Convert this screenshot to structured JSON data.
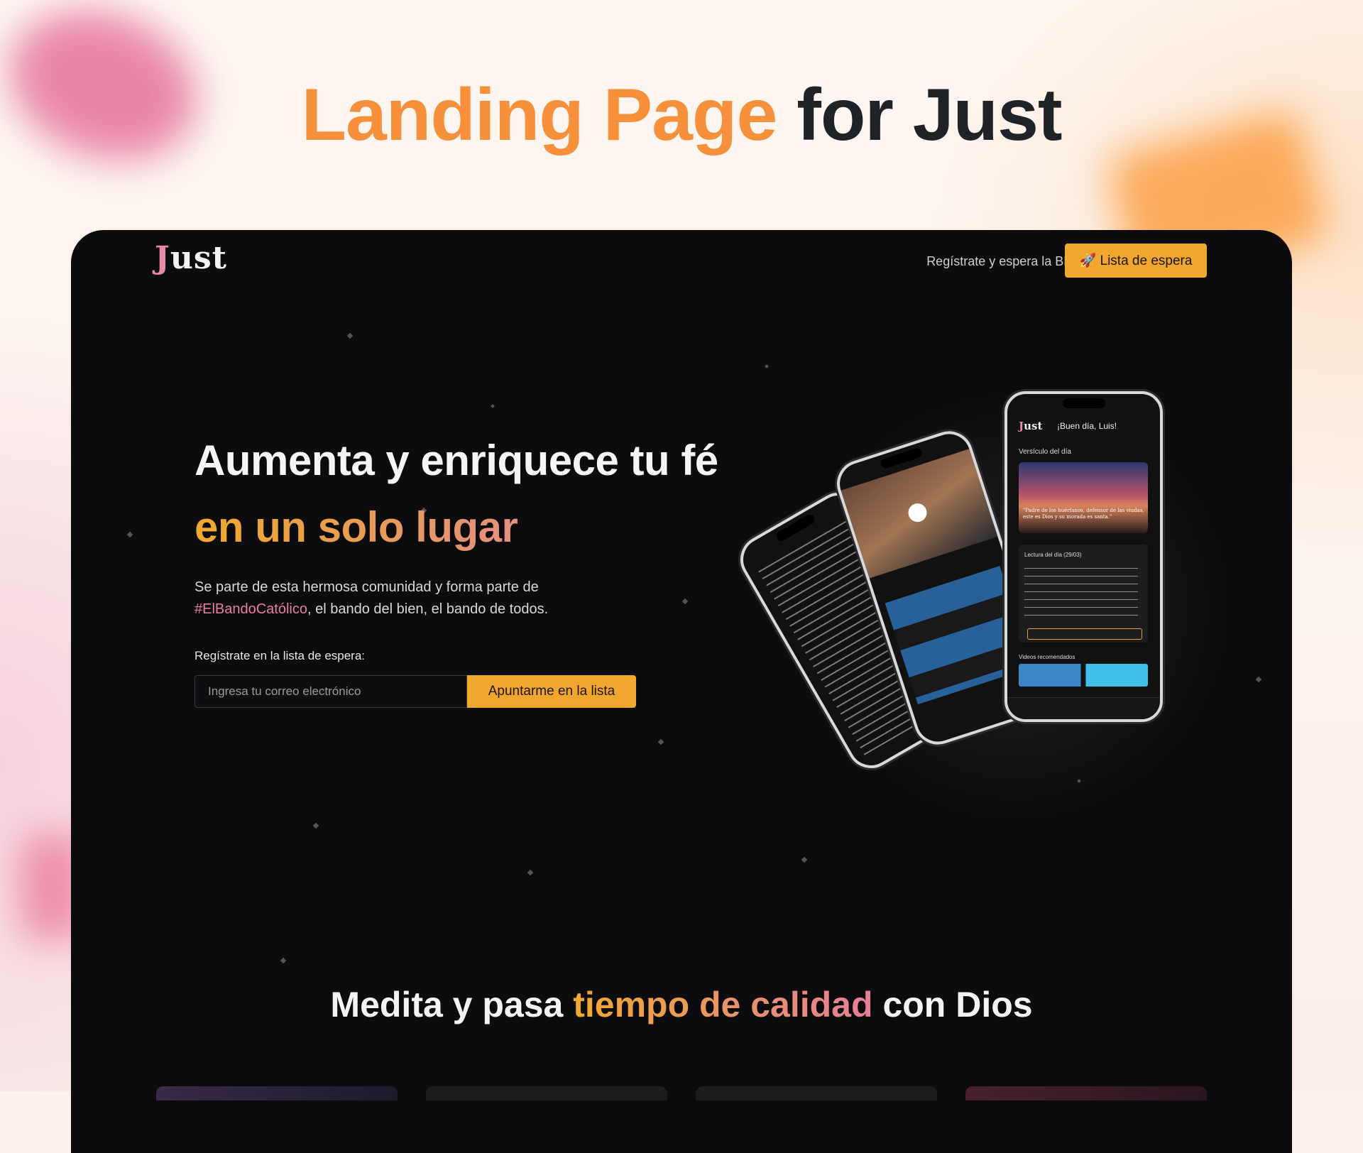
{
  "page_heading": {
    "accent": "Landing Page",
    "rest": "for Just"
  },
  "site": {
    "logo": {
      "first_letter": "J",
      "rest": "ust"
    },
    "nav": {
      "beta_text": "Regístrate y espera la BETA en la:",
      "waitlist_button": "🚀 Lista de espera"
    },
    "hero": {
      "title_line1": "Aumenta y enriquece tu fé",
      "title_line2": "en un solo lugar",
      "description_part1": "Se parte de esta hermosa comunidad y forma parte de ",
      "hashtag": "#ElBandoCatólico",
      "description_part2": ", el bando del bien, el bando de todos.",
      "form_label": "Regístrate en la lista de espera:",
      "email_placeholder": "Ingresa tu correo electrónico",
      "submit_button": "Apuntarme en la lista"
    },
    "phone_front": {
      "logo": "Just",
      "greeting": "¡Buen día, Luis!",
      "verse_heading": "Versículo del día",
      "verse_text": "\"Padre de los huérfanos, defensor de las viudas, este es Dios y su morada es santa.\"",
      "reading_heading": "Lectura del día (29/03)",
      "recommended_heading": "Videos recomendados"
    },
    "section2": {
      "title_part1": "Medita y pasa ",
      "title_highlight": "tiempo de calidad",
      "title_part2": " con Dios"
    }
  },
  "colors": {
    "accent_orange": "#f7903b",
    "button_yellow": "#f1a72f",
    "hashtag_pink": "#e97fa2",
    "frame_bg": "#0c0c0e"
  }
}
